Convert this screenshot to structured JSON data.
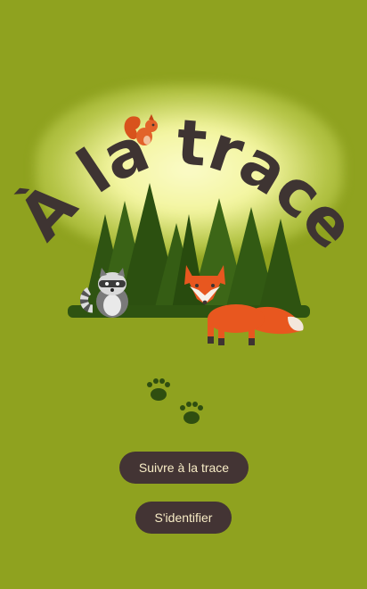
{
  "title": "À la trace",
  "buttons": {
    "follow_label": "Suivre à la trace",
    "login_label": "S'identifier"
  },
  "colors": {
    "background": "#8fa21f",
    "button_bg": "#433434",
    "button_text": "#f8ecc6",
    "title": "#3e3432"
  },
  "illustrations": [
    "squirrel-icon",
    "forest",
    "raccoon-icon",
    "fox-icon",
    "paw-prints-icon"
  ]
}
